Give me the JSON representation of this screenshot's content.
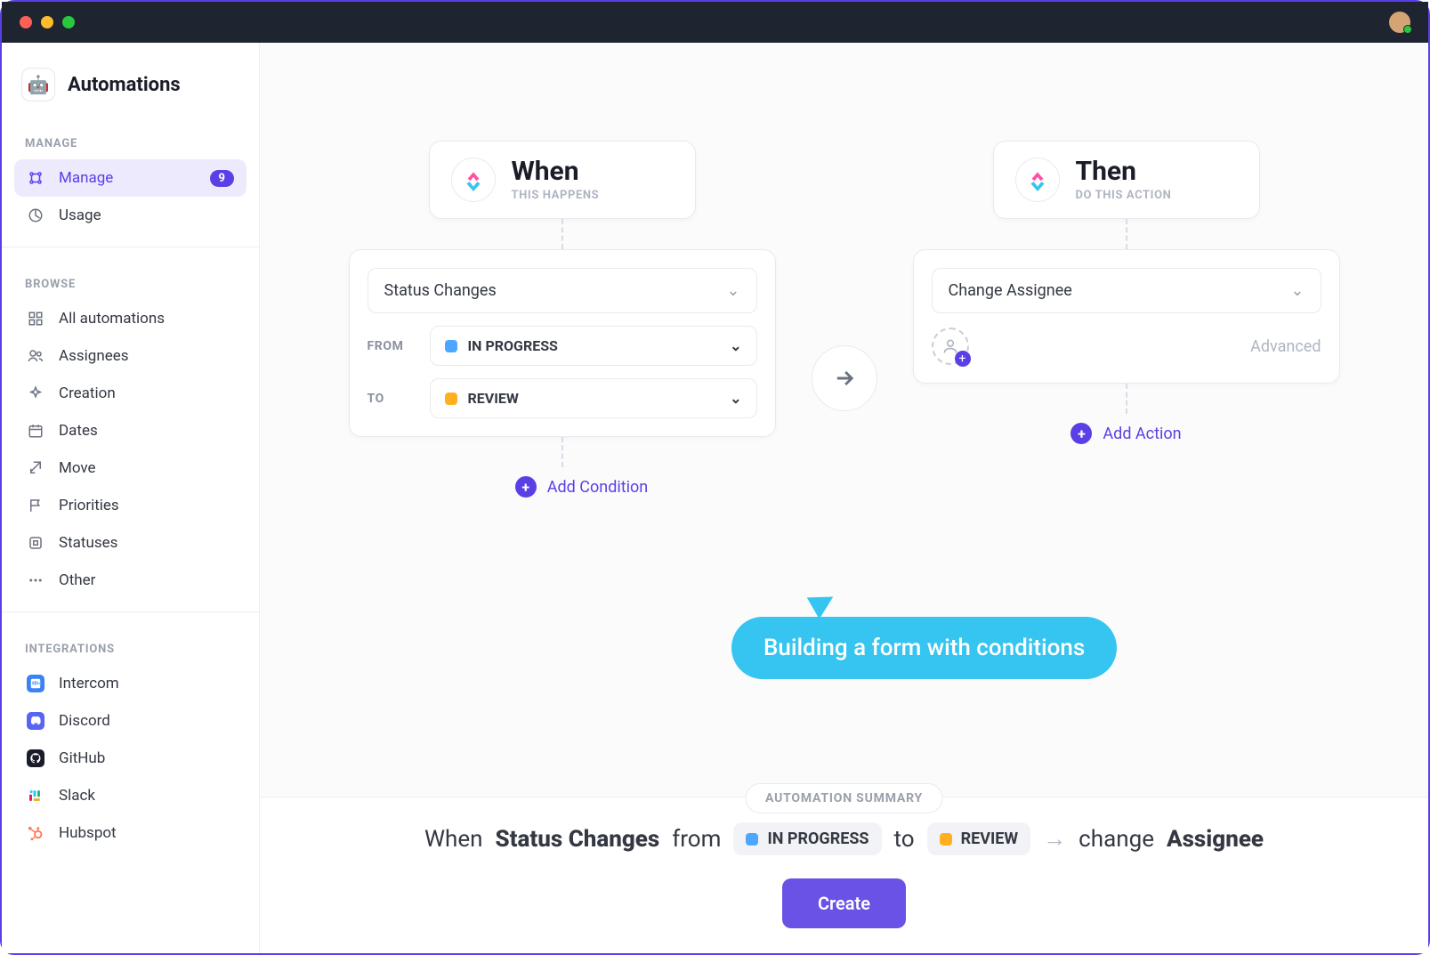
{
  "titlebar": {
    "avatar": true
  },
  "sidebar": {
    "title": "Automations",
    "sections": {
      "manage": {
        "label": "MANAGE",
        "items": [
          {
            "label": "Manage",
            "badge": "9",
            "active": true
          },
          {
            "label": "Usage"
          }
        ]
      },
      "browse": {
        "label": "BROWSE",
        "items": [
          {
            "label": "All automations"
          },
          {
            "label": "Assignees"
          },
          {
            "label": "Creation"
          },
          {
            "label": "Dates"
          },
          {
            "label": "Move"
          },
          {
            "label": "Priorities"
          },
          {
            "label": "Statuses"
          },
          {
            "label": "Other"
          }
        ]
      },
      "integrations": {
        "label": "INTEGRATIONS",
        "items": [
          {
            "label": "Intercom",
            "color": "#3b82f6"
          },
          {
            "label": "Discord",
            "color": "#5865f2"
          },
          {
            "label": "GitHub",
            "color": "#1a1d29"
          },
          {
            "label": "Slack",
            "color": ""
          },
          {
            "label": "Hubspot",
            "color": "#ff7a59"
          }
        ]
      }
    }
  },
  "builder": {
    "when": {
      "title": "When",
      "subtitle": "THIS HAPPENS",
      "trigger": "Status Changes",
      "from_label": "FROM",
      "from_value": "IN PROGRESS",
      "to_label": "TO",
      "to_value": "REVIEW",
      "add_condition": "Add Condition"
    },
    "then": {
      "title": "Then",
      "subtitle": "DO THIS ACTION",
      "action": "Change Assignee",
      "advanced": "Advanced",
      "add_action": "Add Action"
    }
  },
  "tooltip": "Building a form with conditions",
  "summary": {
    "label": "AUTOMATION SUMMARY",
    "when": "When",
    "trigger": "Status Changes",
    "from_word": "from",
    "from_value": "IN PROGRESS",
    "to_word": "to",
    "to_value": "REVIEW",
    "action_word": "change",
    "action_target": "Assignee",
    "create": "Create"
  }
}
